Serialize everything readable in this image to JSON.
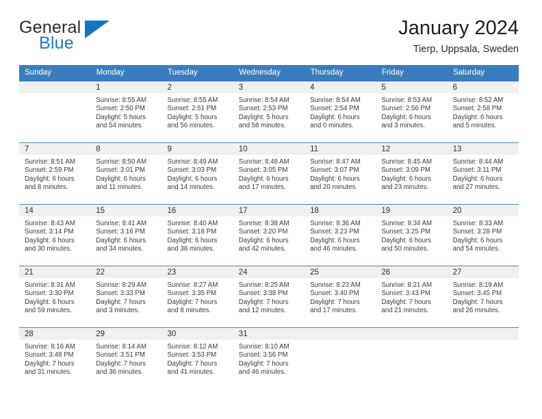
{
  "brand": {
    "name_top": "General",
    "name_bottom": "Blue",
    "triangle_icon": "blue-triangle-logo-mark",
    "accent_color": "#1277c4"
  },
  "header": {
    "title": "January 2024",
    "subtitle": "Tierp, Uppsala, Sweden"
  },
  "theme": {
    "header_row_bg": "#3a7dbe",
    "daynum_band_bg": "#f0f0f0",
    "grid_line": "#4a86c0",
    "text": "#3a3a3a"
  },
  "calendar": {
    "weekday_headers": [
      "Sunday",
      "Monday",
      "Tuesday",
      "Wednesday",
      "Thursday",
      "Friday",
      "Saturday"
    ],
    "labels": {
      "sunrise": "Sunrise:",
      "sunset": "Sunset:",
      "daylight": "Daylight:"
    },
    "weeks": [
      [
        {
          "day": "",
          "empty": true
        },
        {
          "day": "1",
          "sunrise": "Sunrise: 8:55 AM",
          "sunset": "Sunset: 2:50 PM",
          "daylight_line1": "Daylight: 5 hours",
          "daylight_line2": "and 54 minutes."
        },
        {
          "day": "2",
          "sunrise": "Sunrise: 8:55 AM",
          "sunset": "Sunset: 2:51 PM",
          "daylight_line1": "Daylight: 5 hours",
          "daylight_line2": "and 56 minutes."
        },
        {
          "day": "3",
          "sunrise": "Sunrise: 8:54 AM",
          "sunset": "Sunset: 2:53 PM",
          "daylight_line1": "Daylight: 5 hours",
          "daylight_line2": "and 58 minutes."
        },
        {
          "day": "4",
          "sunrise": "Sunrise: 8:54 AM",
          "sunset": "Sunset: 2:54 PM",
          "daylight_line1": "Daylight: 6 hours",
          "daylight_line2": "and 0 minutes."
        },
        {
          "day": "5",
          "sunrise": "Sunrise: 8:53 AM",
          "sunset": "Sunset: 2:56 PM",
          "daylight_line1": "Daylight: 6 hours",
          "daylight_line2": "and 3 minutes."
        },
        {
          "day": "6",
          "sunrise": "Sunrise: 8:52 AM",
          "sunset": "Sunset: 2:58 PM",
          "daylight_line1": "Daylight: 6 hours",
          "daylight_line2": "and 5 minutes."
        }
      ],
      [
        {
          "day": "7",
          "sunrise": "Sunrise: 8:51 AM",
          "sunset": "Sunset: 2:59 PM",
          "daylight_line1": "Daylight: 6 hours",
          "daylight_line2": "and 8 minutes."
        },
        {
          "day": "8",
          "sunrise": "Sunrise: 8:50 AM",
          "sunset": "Sunset: 3:01 PM",
          "daylight_line1": "Daylight: 6 hours",
          "daylight_line2": "and 11 minutes."
        },
        {
          "day": "9",
          "sunrise": "Sunrise: 8:49 AM",
          "sunset": "Sunset: 3:03 PM",
          "daylight_line1": "Daylight: 6 hours",
          "daylight_line2": "and 14 minutes."
        },
        {
          "day": "10",
          "sunrise": "Sunrise: 8:48 AM",
          "sunset": "Sunset: 3:05 PM",
          "daylight_line1": "Daylight: 6 hours",
          "daylight_line2": "and 17 minutes."
        },
        {
          "day": "11",
          "sunrise": "Sunrise: 8:47 AM",
          "sunset": "Sunset: 3:07 PM",
          "daylight_line1": "Daylight: 6 hours",
          "daylight_line2": "and 20 minutes."
        },
        {
          "day": "12",
          "sunrise": "Sunrise: 8:45 AM",
          "sunset": "Sunset: 3:09 PM",
          "daylight_line1": "Daylight: 6 hours",
          "daylight_line2": "and 23 minutes."
        },
        {
          "day": "13",
          "sunrise": "Sunrise: 8:44 AM",
          "sunset": "Sunset: 3:11 PM",
          "daylight_line1": "Daylight: 6 hours",
          "daylight_line2": "and 27 minutes."
        }
      ],
      [
        {
          "day": "14",
          "sunrise": "Sunrise: 8:43 AM",
          "sunset": "Sunset: 3:14 PM",
          "daylight_line1": "Daylight: 6 hours",
          "daylight_line2": "and 30 minutes."
        },
        {
          "day": "15",
          "sunrise": "Sunrise: 8:41 AM",
          "sunset": "Sunset: 3:16 PM",
          "daylight_line1": "Daylight: 6 hours",
          "daylight_line2": "and 34 minutes."
        },
        {
          "day": "16",
          "sunrise": "Sunrise: 8:40 AM",
          "sunset": "Sunset: 3:18 PM",
          "daylight_line1": "Daylight: 6 hours",
          "daylight_line2": "and 38 minutes."
        },
        {
          "day": "17",
          "sunrise": "Sunrise: 8:38 AM",
          "sunset": "Sunset: 3:20 PM",
          "daylight_line1": "Daylight: 6 hours",
          "daylight_line2": "and 42 minutes."
        },
        {
          "day": "18",
          "sunrise": "Sunrise: 8:36 AM",
          "sunset": "Sunset: 3:23 PM",
          "daylight_line1": "Daylight: 6 hours",
          "daylight_line2": "and 46 minutes."
        },
        {
          "day": "19",
          "sunrise": "Sunrise: 8:34 AM",
          "sunset": "Sunset: 3:25 PM",
          "daylight_line1": "Daylight: 6 hours",
          "daylight_line2": "and 50 minutes."
        },
        {
          "day": "20",
          "sunrise": "Sunrise: 8:33 AM",
          "sunset": "Sunset: 3:28 PM",
          "daylight_line1": "Daylight: 6 hours",
          "daylight_line2": "and 54 minutes."
        }
      ],
      [
        {
          "day": "21",
          "sunrise": "Sunrise: 8:31 AM",
          "sunset": "Sunset: 3:30 PM",
          "daylight_line1": "Daylight: 6 hours",
          "daylight_line2": "and 59 minutes."
        },
        {
          "day": "22",
          "sunrise": "Sunrise: 8:29 AM",
          "sunset": "Sunset: 3:33 PM",
          "daylight_line1": "Daylight: 7 hours",
          "daylight_line2": "and 3 minutes."
        },
        {
          "day": "23",
          "sunrise": "Sunrise: 8:27 AM",
          "sunset": "Sunset: 3:35 PM",
          "daylight_line1": "Daylight: 7 hours",
          "daylight_line2": "and 8 minutes."
        },
        {
          "day": "24",
          "sunrise": "Sunrise: 8:25 AM",
          "sunset": "Sunset: 3:38 PM",
          "daylight_line1": "Daylight: 7 hours",
          "daylight_line2": "and 12 minutes."
        },
        {
          "day": "25",
          "sunrise": "Sunrise: 8:23 AM",
          "sunset": "Sunset: 3:40 PM",
          "daylight_line1": "Daylight: 7 hours",
          "daylight_line2": "and 17 minutes."
        },
        {
          "day": "26",
          "sunrise": "Sunrise: 8:21 AM",
          "sunset": "Sunset: 3:43 PM",
          "daylight_line1": "Daylight: 7 hours",
          "daylight_line2": "and 21 minutes."
        },
        {
          "day": "27",
          "sunrise": "Sunrise: 8:19 AM",
          "sunset": "Sunset: 3:45 PM",
          "daylight_line1": "Daylight: 7 hours",
          "daylight_line2": "and 26 minutes."
        }
      ],
      [
        {
          "day": "28",
          "sunrise": "Sunrise: 8:16 AM",
          "sunset": "Sunset: 3:48 PM",
          "daylight_line1": "Daylight: 7 hours",
          "daylight_line2": "and 31 minutes."
        },
        {
          "day": "29",
          "sunrise": "Sunrise: 8:14 AM",
          "sunset": "Sunset: 3:51 PM",
          "daylight_line1": "Daylight: 7 hours",
          "daylight_line2": "and 36 minutes."
        },
        {
          "day": "30",
          "sunrise": "Sunrise: 8:12 AM",
          "sunset": "Sunset: 3:53 PM",
          "daylight_line1": "Daylight: 7 hours",
          "daylight_line2": "and 41 minutes."
        },
        {
          "day": "31",
          "sunrise": "Sunrise: 8:10 AM",
          "sunset": "Sunset: 3:56 PM",
          "daylight_line1": "Daylight: 7 hours",
          "daylight_line2": "and 46 minutes."
        },
        {
          "day": "",
          "empty": true
        },
        {
          "day": "",
          "empty": true
        },
        {
          "day": "",
          "empty": true
        }
      ]
    ]
  }
}
